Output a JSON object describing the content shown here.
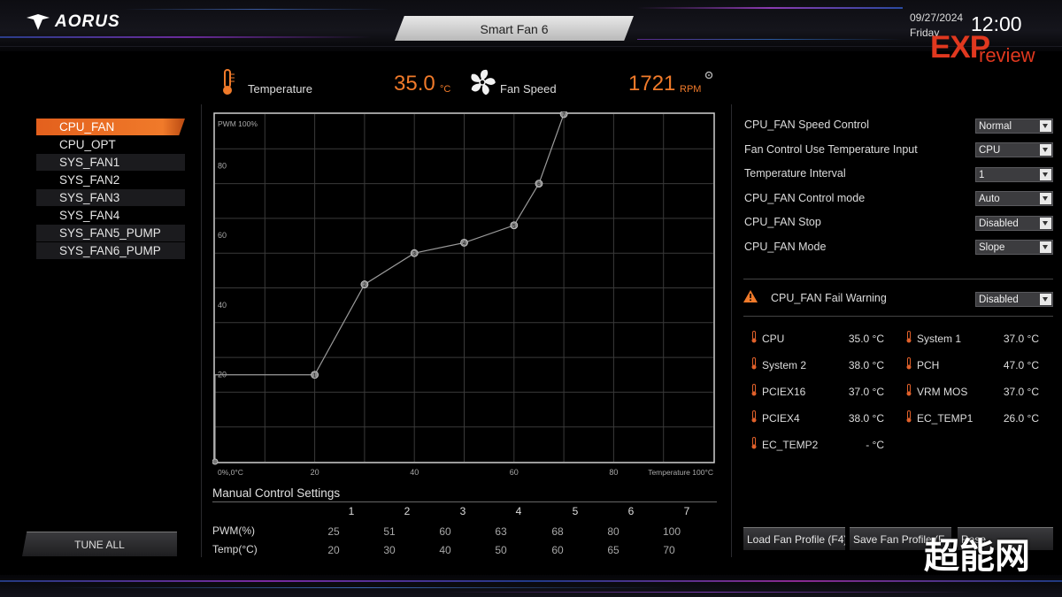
{
  "header": {
    "brand": "AORUS",
    "title": "Smart Fan 6",
    "date": "09/27/2024",
    "day": "Friday",
    "time": "12:00",
    "watermark_exp": "EXP",
    "watermark_review": "review",
    "watermark_cn": "超能网"
  },
  "readout": {
    "temperature_label": "Temperature",
    "temperature_value": "35.0",
    "temperature_unit": "°C",
    "fan_speed_label": "Fan Speed",
    "fan_speed_value": "1721",
    "fan_speed_unit": "RPM"
  },
  "fan_list": [
    {
      "label": "CPU_FAN",
      "selected": true
    },
    {
      "label": "CPU_OPT",
      "selected": false
    },
    {
      "label": "SYS_FAN1",
      "selected": false
    },
    {
      "label": "SYS_FAN2",
      "selected": false
    },
    {
      "label": "SYS_FAN3",
      "selected": false
    },
    {
      "label": "SYS_FAN4",
      "selected": false
    },
    {
      "label": "SYS_FAN5_PUMP",
      "selected": false
    },
    {
      "label": "SYS_FAN6_PUMP",
      "selected": false
    }
  ],
  "tune_all_label": "TUNE ALL",
  "chart_data": {
    "type": "line",
    "title": "",
    "ylabel": "PWM 100%",
    "xlabel": "Temperature 100°C",
    "origin_label": "0%,0°C",
    "x_ticks": [
      "20",
      "40",
      "60",
      "80"
    ],
    "y_ticks": [
      "20",
      "40",
      "60",
      "80"
    ],
    "xlim": [
      0,
      100
    ],
    "ylim": [
      0,
      100
    ],
    "grid": true,
    "points": [
      {
        "id": "1",
        "x": 20,
        "y": 25
      },
      {
        "id": "2",
        "x": 30,
        "y": 51
      },
      {
        "id": "3",
        "x": 40,
        "y": 60
      },
      {
        "id": "4",
        "x": 50,
        "y": 63
      },
      {
        "id": "5",
        "x": 60,
        "y": 68
      },
      {
        "id": "6",
        "x": 65,
        "y": 80
      },
      {
        "id": "7",
        "x": 70,
        "y": 100
      }
    ],
    "line_color": "#9a9a9a"
  },
  "manual": {
    "title": "Manual Control Settings",
    "columns": [
      "1",
      "2",
      "3",
      "4",
      "5",
      "6",
      "7"
    ],
    "pwm_label": "PWM(%)",
    "temp_label": "Temp(°C)",
    "pwm": [
      "25",
      "51",
      "60",
      "63",
      "68",
      "80",
      "100"
    ],
    "temp": [
      "20",
      "30",
      "40",
      "50",
      "60",
      "65",
      "70"
    ]
  },
  "settings": [
    {
      "label": "CPU_FAN Speed Control",
      "value": "Normal"
    },
    {
      "label": "Fan Control Use Temperature Input",
      "value": "CPU"
    },
    {
      "label": "Temperature Interval",
      "value": "1"
    },
    {
      "label": "CPU_FAN Control mode",
      "value": "Auto"
    },
    {
      "label": "CPU_FAN Stop",
      "value": "Disabled"
    },
    {
      "label": "CPU_FAN Mode",
      "value": "Slope"
    }
  ],
  "fail_warning": {
    "label": "CPU_FAN Fail Warning",
    "value": "Disabled",
    "icon": "warning-icon",
    "color": "#f07a2a"
  },
  "temps": [
    {
      "name": "CPU",
      "value": "35.0 °C"
    },
    {
      "name": "System 1",
      "value": "37.0 °C"
    },
    {
      "name": "System 2",
      "value": "38.0 °C"
    },
    {
      "name": "PCH",
      "value": "47.0 °C"
    },
    {
      "name": "PCIEX16",
      "value": "37.0 °C"
    },
    {
      "name": "VRM MOS",
      "value": "37.0 °C"
    },
    {
      "name": "PCIEX4",
      "value": "38.0 °C"
    },
    {
      "name": "EC_TEMP1",
      "value": "26.0 °C"
    },
    {
      "name": "EC_TEMP2",
      "value": "- °C"
    }
  ],
  "buttons": {
    "load": "Load Fan Profile (F4)",
    "save": "Save Fan Profile (F",
    "third": "Rese"
  },
  "colors": {
    "accent": "#f07a2a",
    "warning": "#e0381f",
    "background": "#000000"
  }
}
